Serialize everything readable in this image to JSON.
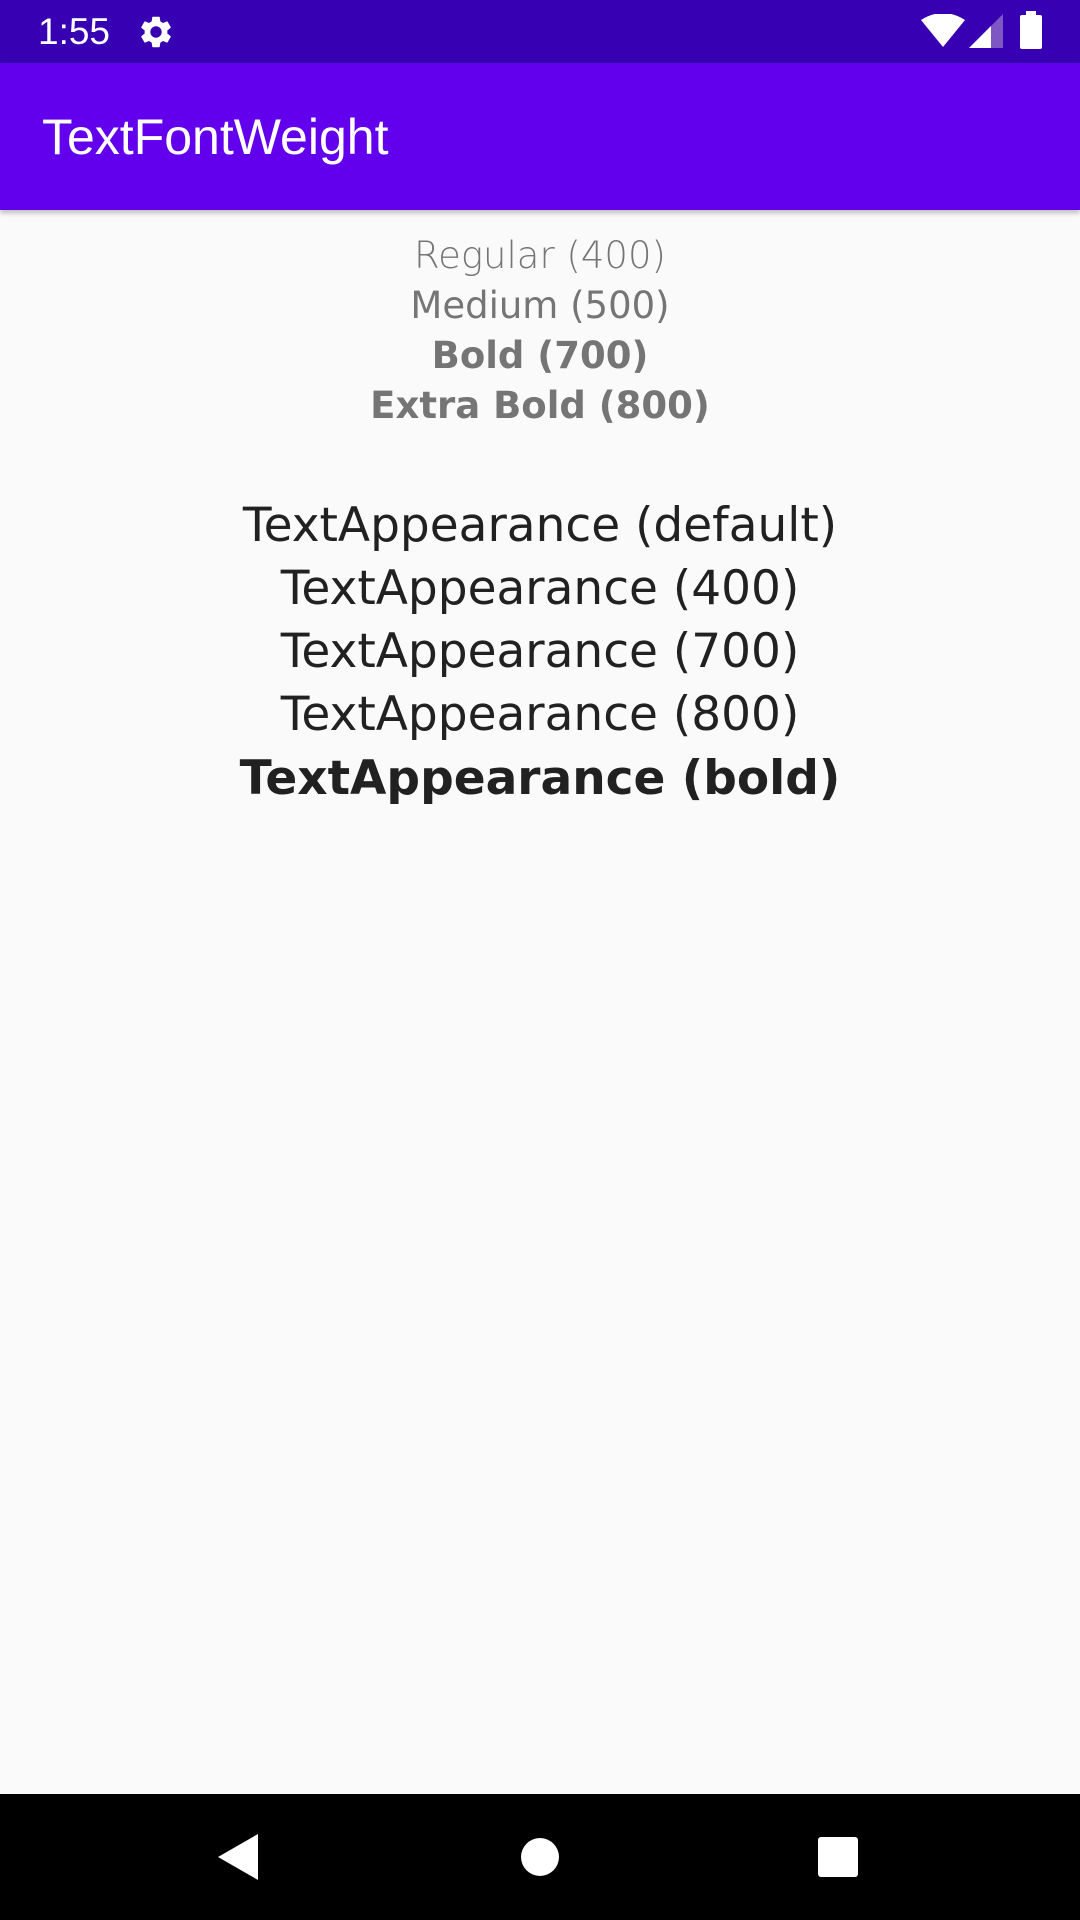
{
  "status_bar": {
    "time": "1:55",
    "icons": [
      "gear-icon",
      "wifi-icon",
      "signal-icon",
      "battery-icon"
    ],
    "background_color": "#3700b3"
  },
  "app_bar": {
    "title": "TextFontWeight",
    "background_color": "#6200ee"
  },
  "font_weights": [
    {
      "label": "Regular (400)",
      "weight": 400
    },
    {
      "label": "Medium (500)",
      "weight": 500
    },
    {
      "label": "Bold (700)",
      "weight": 700
    },
    {
      "label": "Extra Bold (800)",
      "weight": 800
    }
  ],
  "text_appearances": [
    {
      "label": "TextAppearance (default)"
    },
    {
      "label": "TextAppearance (400)"
    },
    {
      "label": "TextAppearance (700)"
    },
    {
      "label": "TextAppearance (800)"
    },
    {
      "label": "TextAppearance (bold)"
    }
  ],
  "nav_bar": {
    "buttons": [
      "back-icon",
      "home-icon",
      "recents-icon"
    ]
  }
}
